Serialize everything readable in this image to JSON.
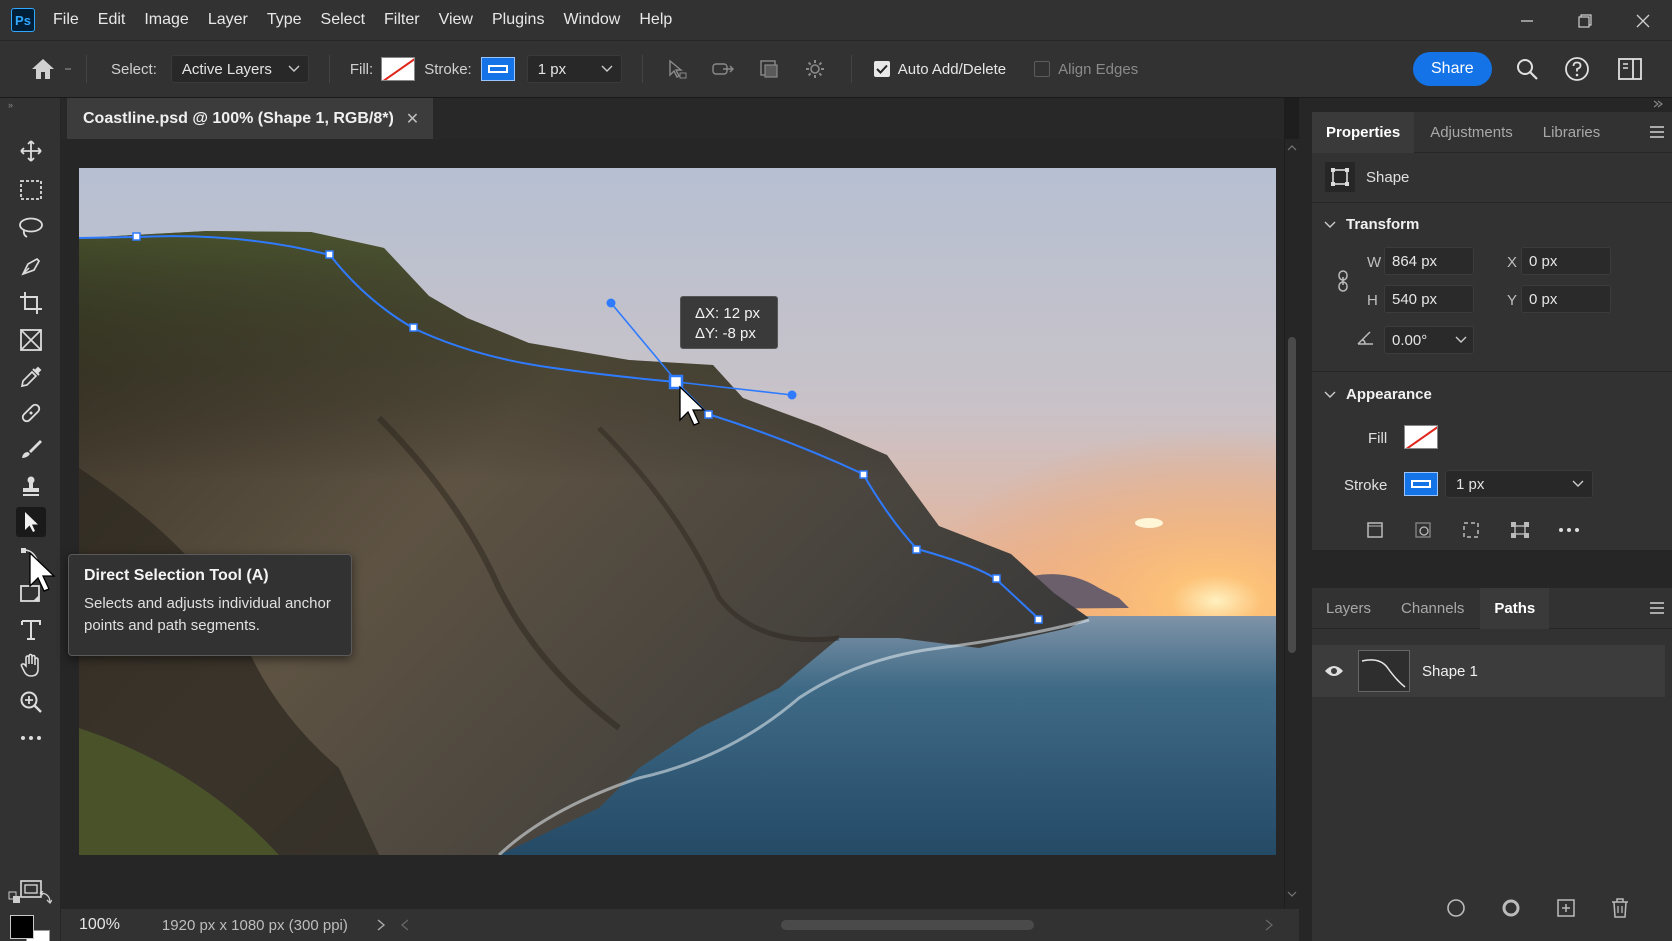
{
  "app": {
    "logo": "Ps",
    "menu": [
      "File",
      "Edit",
      "Image",
      "Layer",
      "Type",
      "Select",
      "Filter",
      "View",
      "Plugins",
      "Window",
      "Help"
    ]
  },
  "options": {
    "select_label": "Select:",
    "select_value": "Active Layers",
    "fill_label": "Fill:",
    "stroke_label": "Stroke:",
    "stroke_width": "1 px",
    "auto_add_delete_label": "Auto Add/Delete",
    "auto_add_delete_checked": true,
    "align_edges_label": "Align Edges",
    "align_edges_checked": false,
    "share_label": "Share"
  },
  "document": {
    "tab_title": "Coastline.psd @ 100% (Shape 1, RGB/8*)",
    "zoom": "100%",
    "info": "1920 px x 1080 px (300 ppi)"
  },
  "hud": {
    "dx": "ΔX: 12 px",
    "dy": "ΔY: -8 px"
  },
  "tool_tooltip": {
    "title": "Direct Selection Tool (A)",
    "description": "Selects and adjusts individual anchor points and path segments."
  },
  "properties": {
    "tabs": [
      "Properties",
      "Adjustments",
      "Libraries"
    ],
    "active_tab": "Properties",
    "kind": "Shape",
    "transform_title": "Transform",
    "w_label": "W",
    "w_value": "864 px",
    "h_label": "H",
    "h_value": "540 px",
    "x_label": "X",
    "x_value": "0 px",
    "y_label": "Y",
    "y_value": "0 px",
    "angle_value": "0.00°",
    "appearance_title": "Appearance",
    "fill_label": "Fill",
    "stroke_label": "Stroke",
    "stroke_width": "1 px"
  },
  "layers_panel": {
    "tabs": [
      "Layers",
      "Channels",
      "Paths"
    ],
    "active_tab": "Paths",
    "paths": [
      {
        "name": "Shape 1"
      }
    ]
  },
  "colors": {
    "accent": "#1473e6",
    "path": "#2f7bff",
    "panel_bg": "#323232",
    "app_bg": "#262626"
  }
}
